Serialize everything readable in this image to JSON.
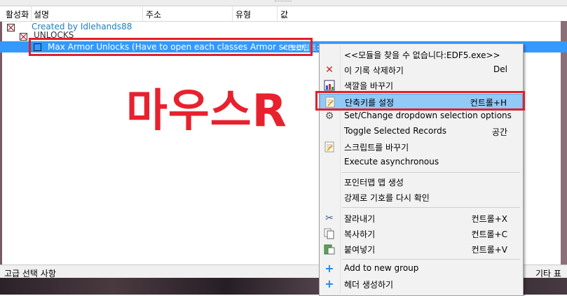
{
  "header": {
    "col_active": "활성화",
    "col_description": "설명",
    "col_address": "주소",
    "col_type": "유형",
    "col_value": "값"
  },
  "rows": {
    "created_by": "Created by Idlehands88",
    "group": "UNLOCKS",
    "selected": "Max Armor Unlocks (Have to open each classes Armor screen)",
    "selected_value": "<스크립트>"
  },
  "overlay_text": "마우스R",
  "bottom": {
    "left": "고급 선택 사항",
    "right": "기타 표"
  },
  "menu": {
    "items": [
      {
        "label": "<<모듈을 찾을 수 없습니다:EDF5.exe>>",
        "shortcut": "",
        "icon": ""
      },
      {
        "label": "이 기록 삭제하기",
        "shortcut": "Del",
        "icon": "delete-icon"
      },
      {
        "label": "색깔을 바꾸기",
        "shortcut": "",
        "icon": "color-icon"
      },
      {
        "label": "단축키를 설정",
        "shortcut": "컨트롤+H",
        "icon": "hotkey-icon"
      },
      {
        "label": "Set/Change dropdown selection options",
        "shortcut": "",
        "icon": "gear-icon"
      },
      {
        "label": "Toggle Selected Records",
        "shortcut": "공간",
        "icon": ""
      },
      {
        "label": "스크립트를 바꾸기",
        "shortcut": "",
        "icon": "script-icon"
      },
      {
        "label": "Execute asynchronous",
        "shortcut": "",
        "icon": ""
      },
      {
        "label": "포인터맵 맵 생성",
        "shortcut": "",
        "icon": ""
      },
      {
        "label": "강제로 기호를 다시 확인",
        "shortcut": "",
        "icon": ""
      },
      {
        "label": "잘라내기",
        "shortcut": "컨트롤+X",
        "icon": "scissors-icon"
      },
      {
        "label": "복사하기",
        "shortcut": "컨트롤+C",
        "icon": "copy-icon"
      },
      {
        "label": "붙여넣기",
        "shortcut": "컨트롤+V",
        "icon": "paste-icon"
      },
      {
        "label": "Add to new group",
        "shortcut": "",
        "icon": "plus-icon"
      },
      {
        "label": "헤더 생성하기",
        "shortcut": "",
        "icon": "plus-icon"
      }
    ]
  },
  "colors": {
    "selection": "#3399ff",
    "menu_highlight": "#91c9f7",
    "annotation_red": "#e0202a",
    "link_blue": "#1a7fc0"
  }
}
